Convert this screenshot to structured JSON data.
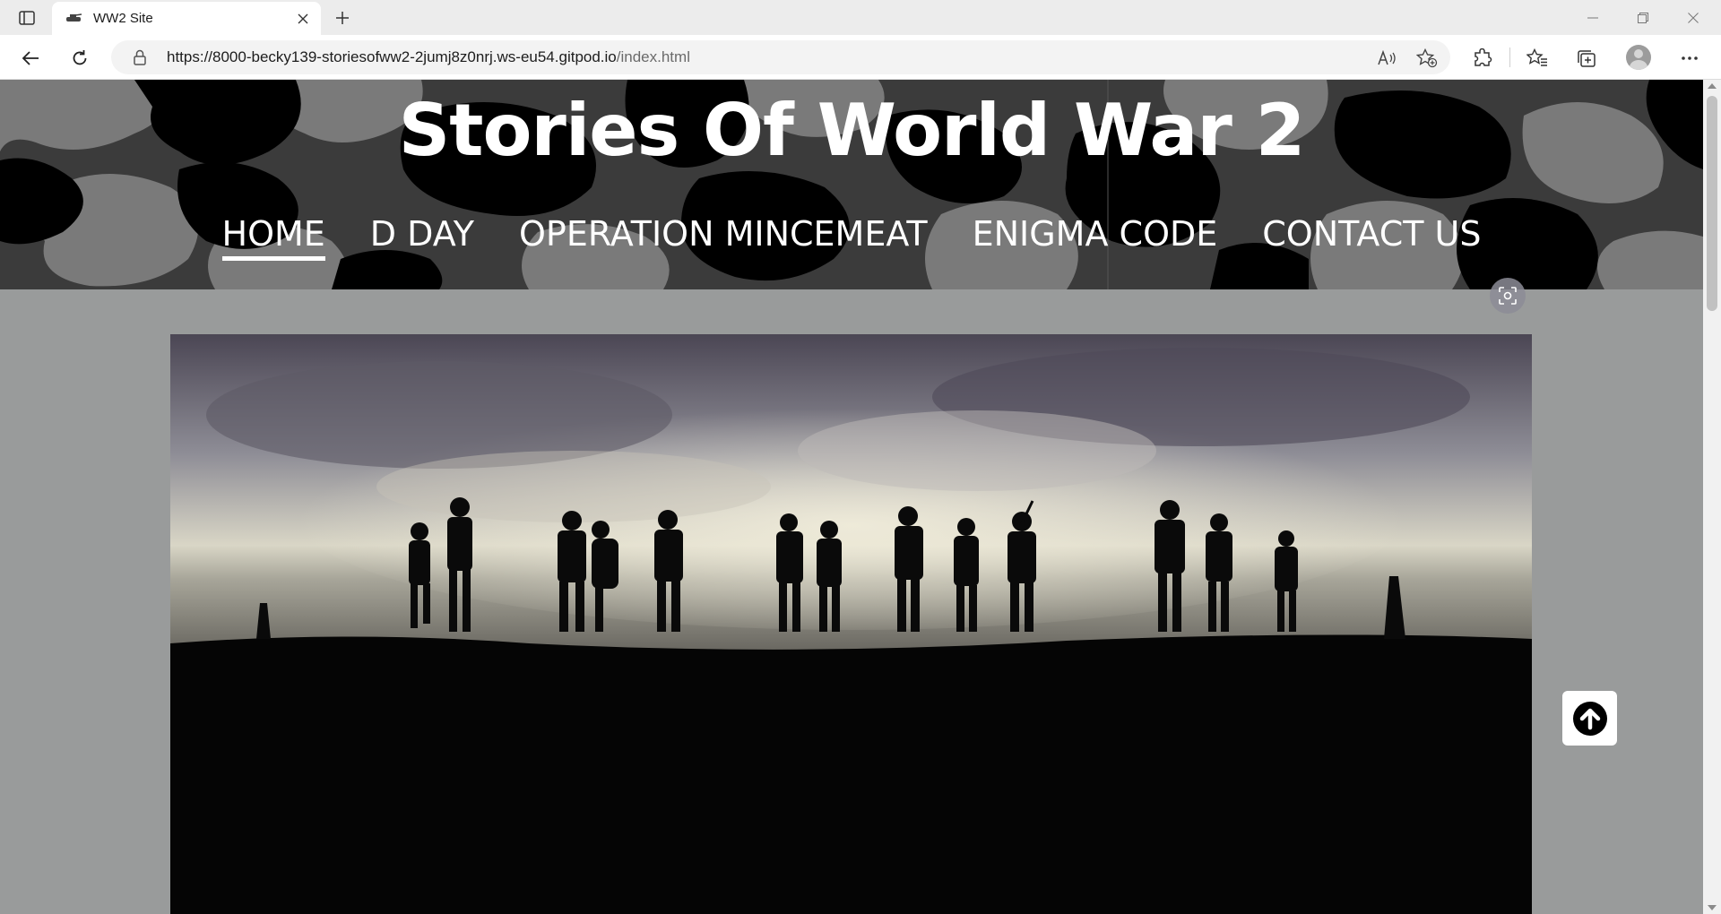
{
  "browser": {
    "tab_title": "WW2 Site",
    "url_host": "https://8000-becky139-storiesofww2-2jumj8z0nrj.ws-eu54.gitpod.io",
    "url_path": "/index.html"
  },
  "icons": {
    "tab_actions": "tab-actions-icon",
    "favicon": "tank-icon",
    "tab_close": "close-icon",
    "new_tab": "plus-icon",
    "minimize": "minimize-icon",
    "restore": "restore-icon",
    "close_window": "close-icon",
    "back": "back-arrow-icon",
    "refresh": "refresh-icon",
    "lock": "lock-icon",
    "read_aloud": "read-aloud-icon",
    "add_favorite": "add-favorite-icon",
    "extensions": "extensions-icon",
    "favorites": "favorites-icon",
    "collections": "collections-icon",
    "profile": "profile-avatar",
    "more": "more-icon",
    "visual_search": "visual-search-icon",
    "scroll_top": "arrow-up-circle-icon"
  },
  "site": {
    "title": "Stories Of World War 2",
    "nav": [
      "HOME",
      "D DAY",
      "OPERATION MINCEMEAT",
      "ENIGMA CODE",
      "CONTACT US"
    ],
    "active_nav": "HOME"
  },
  "colors": {
    "page_bg": "#999b9b",
    "camo_dark": "#000000",
    "camo_mid": "#3b3b3b",
    "camo_light": "#7a7a7a",
    "nav_text": "#ffffff"
  }
}
